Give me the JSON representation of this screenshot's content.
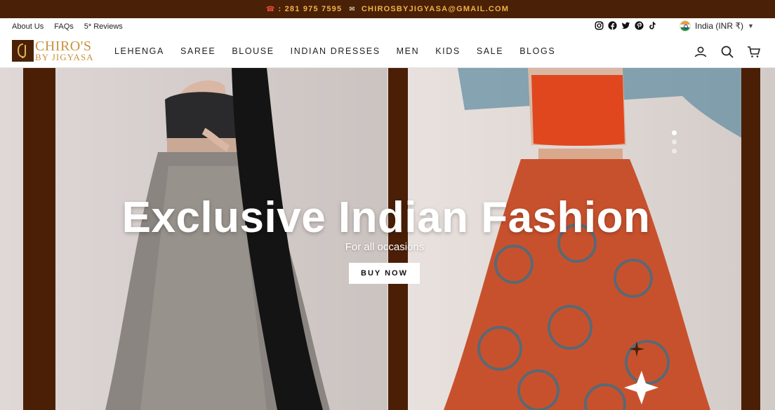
{
  "announcement": {
    "phone": ": 281 975 7595",
    "email": "CHIROSBYJIGYASA@GMAIL.COM",
    "phone_icon": "phone-icon",
    "email_icon": "envelope-icon"
  },
  "utility_links": [
    "About Us",
    "FAQs",
    "5* Reviews"
  ],
  "social_icons": [
    "instagram-icon",
    "facebook-icon",
    "twitter-icon",
    "pinterest-icon",
    "tiktok-icon"
  ],
  "currency": {
    "label": "India (INR ₹)",
    "flag_icon": "india-flag-icon"
  },
  "logo": {
    "mark": "CJ",
    "line1": "CHIRO'S",
    "line2": "BY JIGYASA"
  },
  "menu": [
    "LEHENGA",
    "SAREE",
    "BLOUSE",
    "INDIAN DRESSES",
    "MEN",
    "KIDS",
    "SALE",
    "BLOGS"
  ],
  "nav_icons": [
    "account-icon",
    "search-icon",
    "cart-icon"
  ],
  "hero": {
    "title": "Exclusive Indian Fashion",
    "subtitle": "For all occasions",
    "button": "BUY NOW",
    "slide_count": 3,
    "active_slide": 1
  },
  "colors": {
    "brand_brown": "#4a2106",
    "announcement_text": "#f2b24a",
    "logo_gold": "#c9923c"
  }
}
